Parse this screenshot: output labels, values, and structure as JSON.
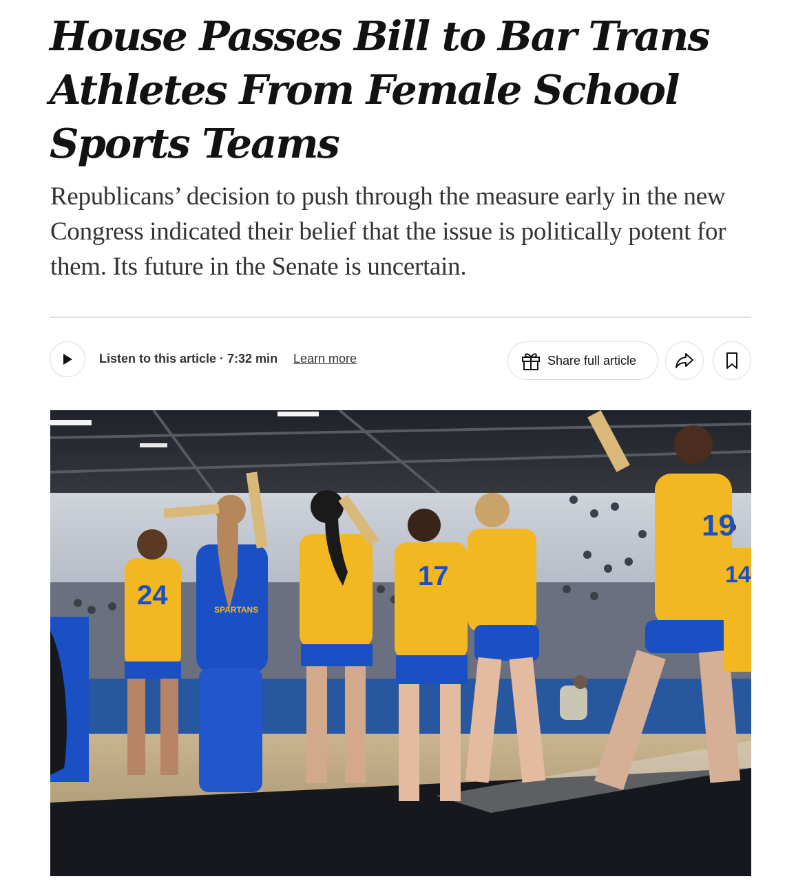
{
  "article": {
    "headline": "House Passes Bill to Bar Trans Athletes From Female School Sports Teams",
    "summary": "Republicans’ decision to push through the measure early in the new Congress indicated their belief that the issue is politically potent for them. Its future in the Senate is uncertain."
  },
  "toolbar": {
    "listen_label": "Listen to this article · 7:32 min",
    "learn_more_label": "Learn more",
    "share_label": "Share full article",
    "icons": {
      "play": "play-icon",
      "gift": "gift-icon",
      "share": "share-arrow-icon",
      "save": "bookmark-icon"
    }
  },
  "photo": {
    "description_visible_text": {
      "jersey_numbers": [
        "24",
        "17",
        "19",
        "14"
      ],
      "warmup_shirt_text": "SPARTANS"
    }
  },
  "colors": {
    "text": "#121212",
    "summary_text": "#333333",
    "divider": "#dfdfdf",
    "jersey_gold": "#f2b721",
    "jersey_blue": "#1b4fc4"
  }
}
